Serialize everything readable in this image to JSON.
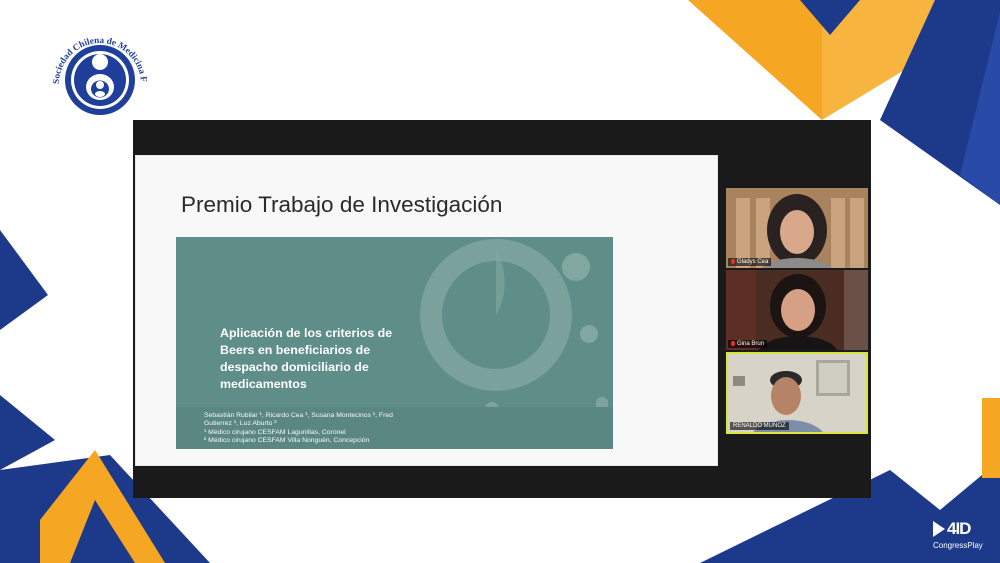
{
  "society_logo": {
    "text": "Sociedad Chilena de Medicina Familiar"
  },
  "slide": {
    "title": "Premio Trabajo de Investigación",
    "paper_title_lines": [
      "Aplicación de los criterios de",
      "Beers en beneficiarios de",
      "despacho domiciliario de",
      "medicamentos"
    ],
    "authors_line1": "Sebastián Rubilar ¹, Ricardo Cea ¹, Susana Montecinos ¹, Fred",
    "authors_line2": "Gutierrez ¹, Luz Aburto ²",
    "affiliation1": "¹ Médico cirujano CESFAM Lagunillas, Coronel",
    "affiliation2": "² Médico cirujano CESFAM Villa Nonguén, Concepción"
  },
  "participants": [
    {
      "name": "Gladys Cea"
    },
    {
      "name": "Gina Brun"
    },
    {
      "name": "RENALDO MUÑOZ"
    }
  ],
  "brand": {
    "main": "4ID",
    "sub": "CongressPlay"
  },
  "colors": {
    "navy": "#1d3a8a",
    "orange": "#f5a623",
    "slide_teal": "#5f8d87",
    "active_speaker_border": "#d6e63c"
  }
}
